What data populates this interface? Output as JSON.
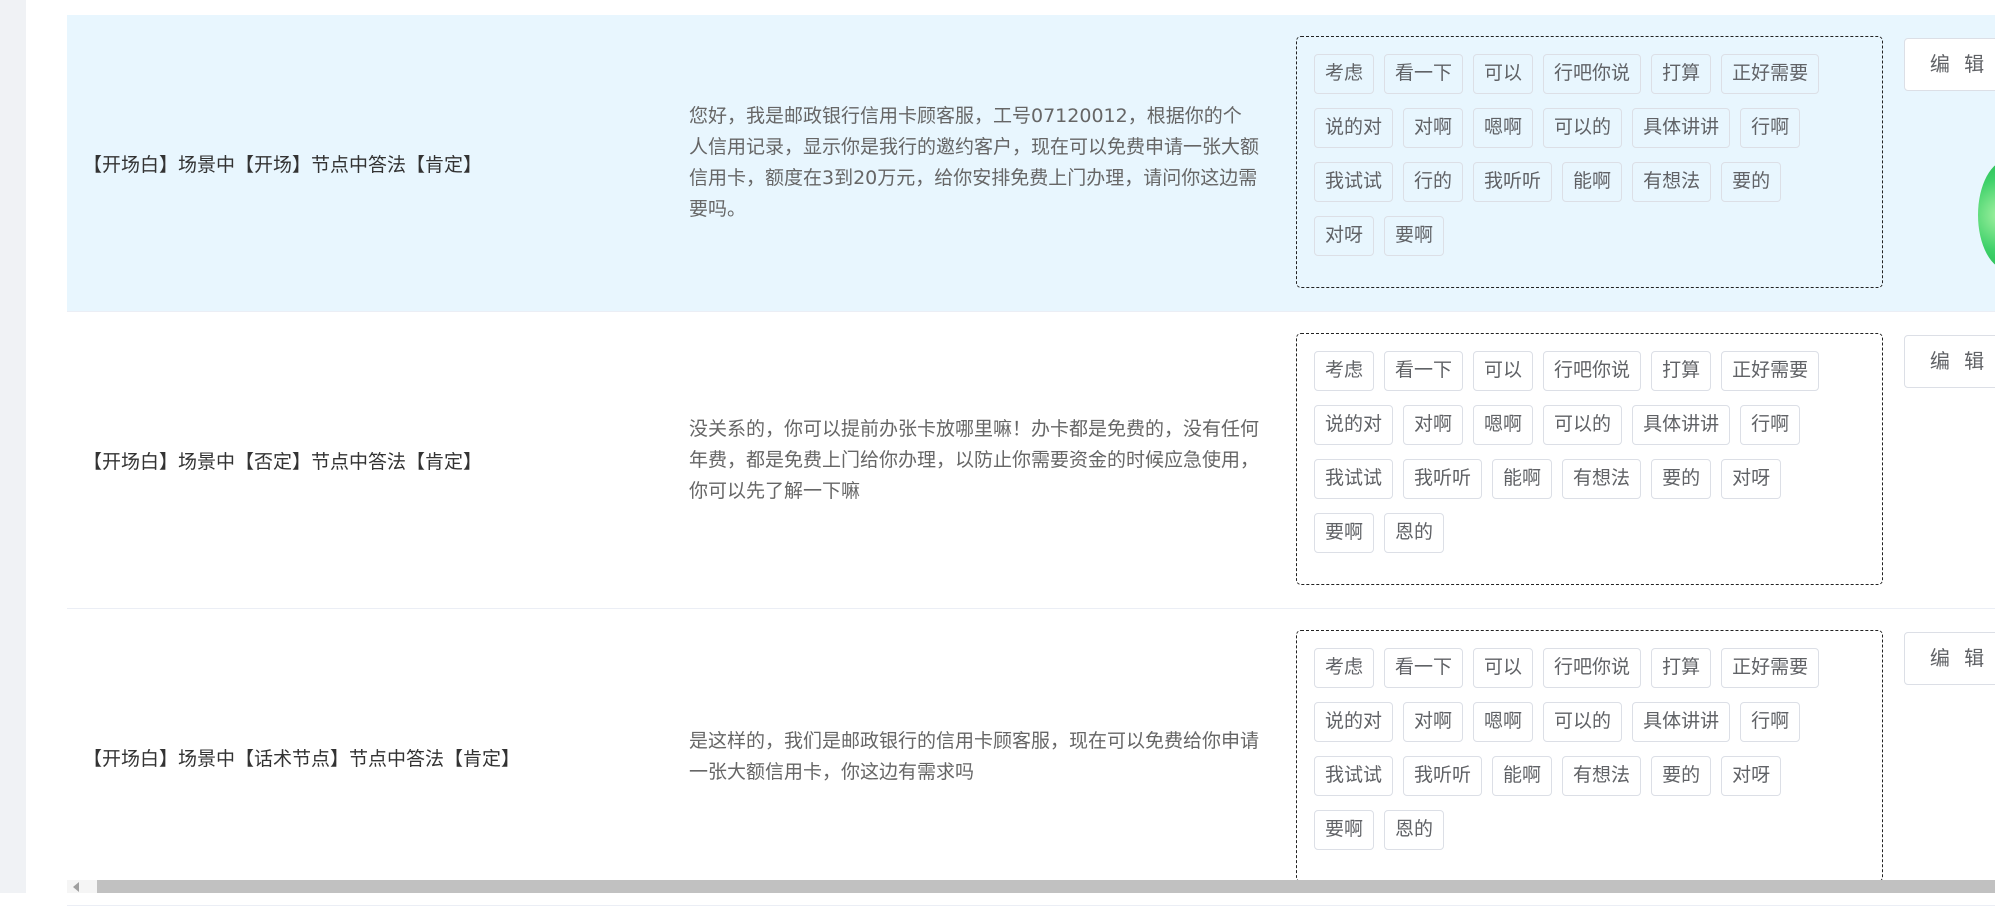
{
  "rows": [
    {
      "title": "【开场白】场景中【开场】节点中答法【肯定】",
      "script": "您好，我是邮政银行信用卡顾客服，工号07120012，根据你的个人信用记录，显示你是我行的邀约客户，现在可以免费申请一张大额信用卡，额度在3到20万元，给你安排免费上门办理，请问你这边需要吗。",
      "keywords": [
        [
          "考虑",
          "看一下",
          "可以",
          "行吧你说",
          "打算",
          "正好需要"
        ],
        [
          "说的对",
          "对啊",
          "嗯啊",
          "可以的",
          "具体讲讲",
          "行啊"
        ],
        [
          "我试试",
          "行的",
          "我听听",
          "能啊",
          "有想法",
          "要的"
        ],
        [
          "对呀",
          "要啊"
        ]
      ],
      "edit_label": "编 辑"
    },
    {
      "title": "【开场白】场景中【否定】节点中答法【肯定】",
      "script": "没关系的，你可以提前办张卡放哪里嘛！办卡都是免费的，没有任何年费，都是免费上门给你办理，以防止你需要资金的时候应急使用，你可以先了解一下嘛",
      "keywords": [
        [
          "考虑",
          "看一下",
          "可以",
          "行吧你说",
          "打算",
          "正好需要"
        ],
        [
          "说的对",
          "对啊",
          "嗯啊",
          "可以的",
          "具体讲讲",
          "行啊"
        ],
        [
          "我试试",
          "我听听",
          "能啊",
          "有想法",
          "要的",
          "对呀"
        ],
        [
          "要啊",
          "恩的"
        ]
      ],
      "edit_label": "编 辑"
    },
    {
      "title": "【开场白】场景中【话术节点】节点中答法【肯定】",
      "script": "是这样的，我们是邮政银行的信用卡顾客服，现在可以免费给你申请一张大额信用卡，你这边有需求吗",
      "keywords": [
        [
          "考虑",
          "看一下",
          "可以",
          "行吧你说",
          "打算",
          "正好需要"
        ],
        [
          "说的对",
          "对啊",
          "嗯啊",
          "可以的",
          "具体讲讲",
          "行啊"
        ],
        [
          "我试试",
          "我听听",
          "能啊",
          "有想法",
          "要的",
          "对呀"
        ],
        [
          "要啊",
          "恩的"
        ]
      ],
      "edit_label": "编 辑"
    }
  ],
  "colors": {
    "highlight_row": "#e8f6fe",
    "tag_border": "#dcdfe6",
    "text": "#333333"
  },
  "icons": {
    "scroll_left": "scroll-left-arrow-icon"
  }
}
